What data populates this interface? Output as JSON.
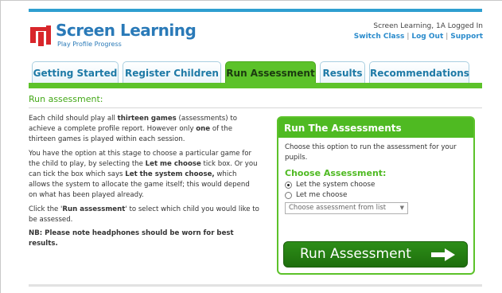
{
  "brand": {
    "title": "Screen Learning",
    "subtitle": "Play Profile Progress",
    "accent_blue": "#2a7ab8",
    "accent_green": "#5cc22a",
    "logo_red": "#d8262b"
  },
  "user": {
    "status": "Screen Learning, 1A Logged In",
    "links": [
      "Switch Class",
      "Log Out",
      "Support"
    ]
  },
  "tabs": [
    {
      "label": "Getting Started",
      "active": false
    },
    {
      "label": "Register Children",
      "active": false
    },
    {
      "label": "Run Assessment",
      "active": true
    },
    {
      "label": "Results",
      "active": false
    },
    {
      "label": "Recommendations",
      "active": false
    }
  ],
  "section": {
    "title": "Run assessment:"
  },
  "description": {
    "p1_a": "Each child should play all ",
    "p1_b": "thirteen games",
    "p1_c": " (assessments) to achieve a complete profile report. However only ",
    "p1_d": "one",
    "p1_e": " of the thirteen games is played within each session.",
    "p2_a": "You have the option at this stage to choose a particular game for the child to play, by selecting the ",
    "p2_b": "Let me choose",
    "p2_c": " tick box. Or you can tick the box which says ",
    "p2_d": "Let the system choose,",
    "p2_e": " which allows the system to allocate the game itself; this would depend on what has been played already.",
    "p3_a": "Click the '",
    "p3_b": "Run assessment",
    "p3_c": "' to select which child you would like to be assessed.",
    "p4": "NB: Please note headphones should be worn for best results."
  },
  "panel": {
    "header": "Run The Assessments",
    "text": "Choose this option to run the assessment for your pupils.",
    "subheading": "Choose Assessment:",
    "options": [
      {
        "label": "Let the system choose",
        "checked": true
      },
      {
        "label": "Let me choose",
        "checked": false
      }
    ],
    "select_placeholder": "Choose assessment from list",
    "run_button": "Run Assessment"
  }
}
